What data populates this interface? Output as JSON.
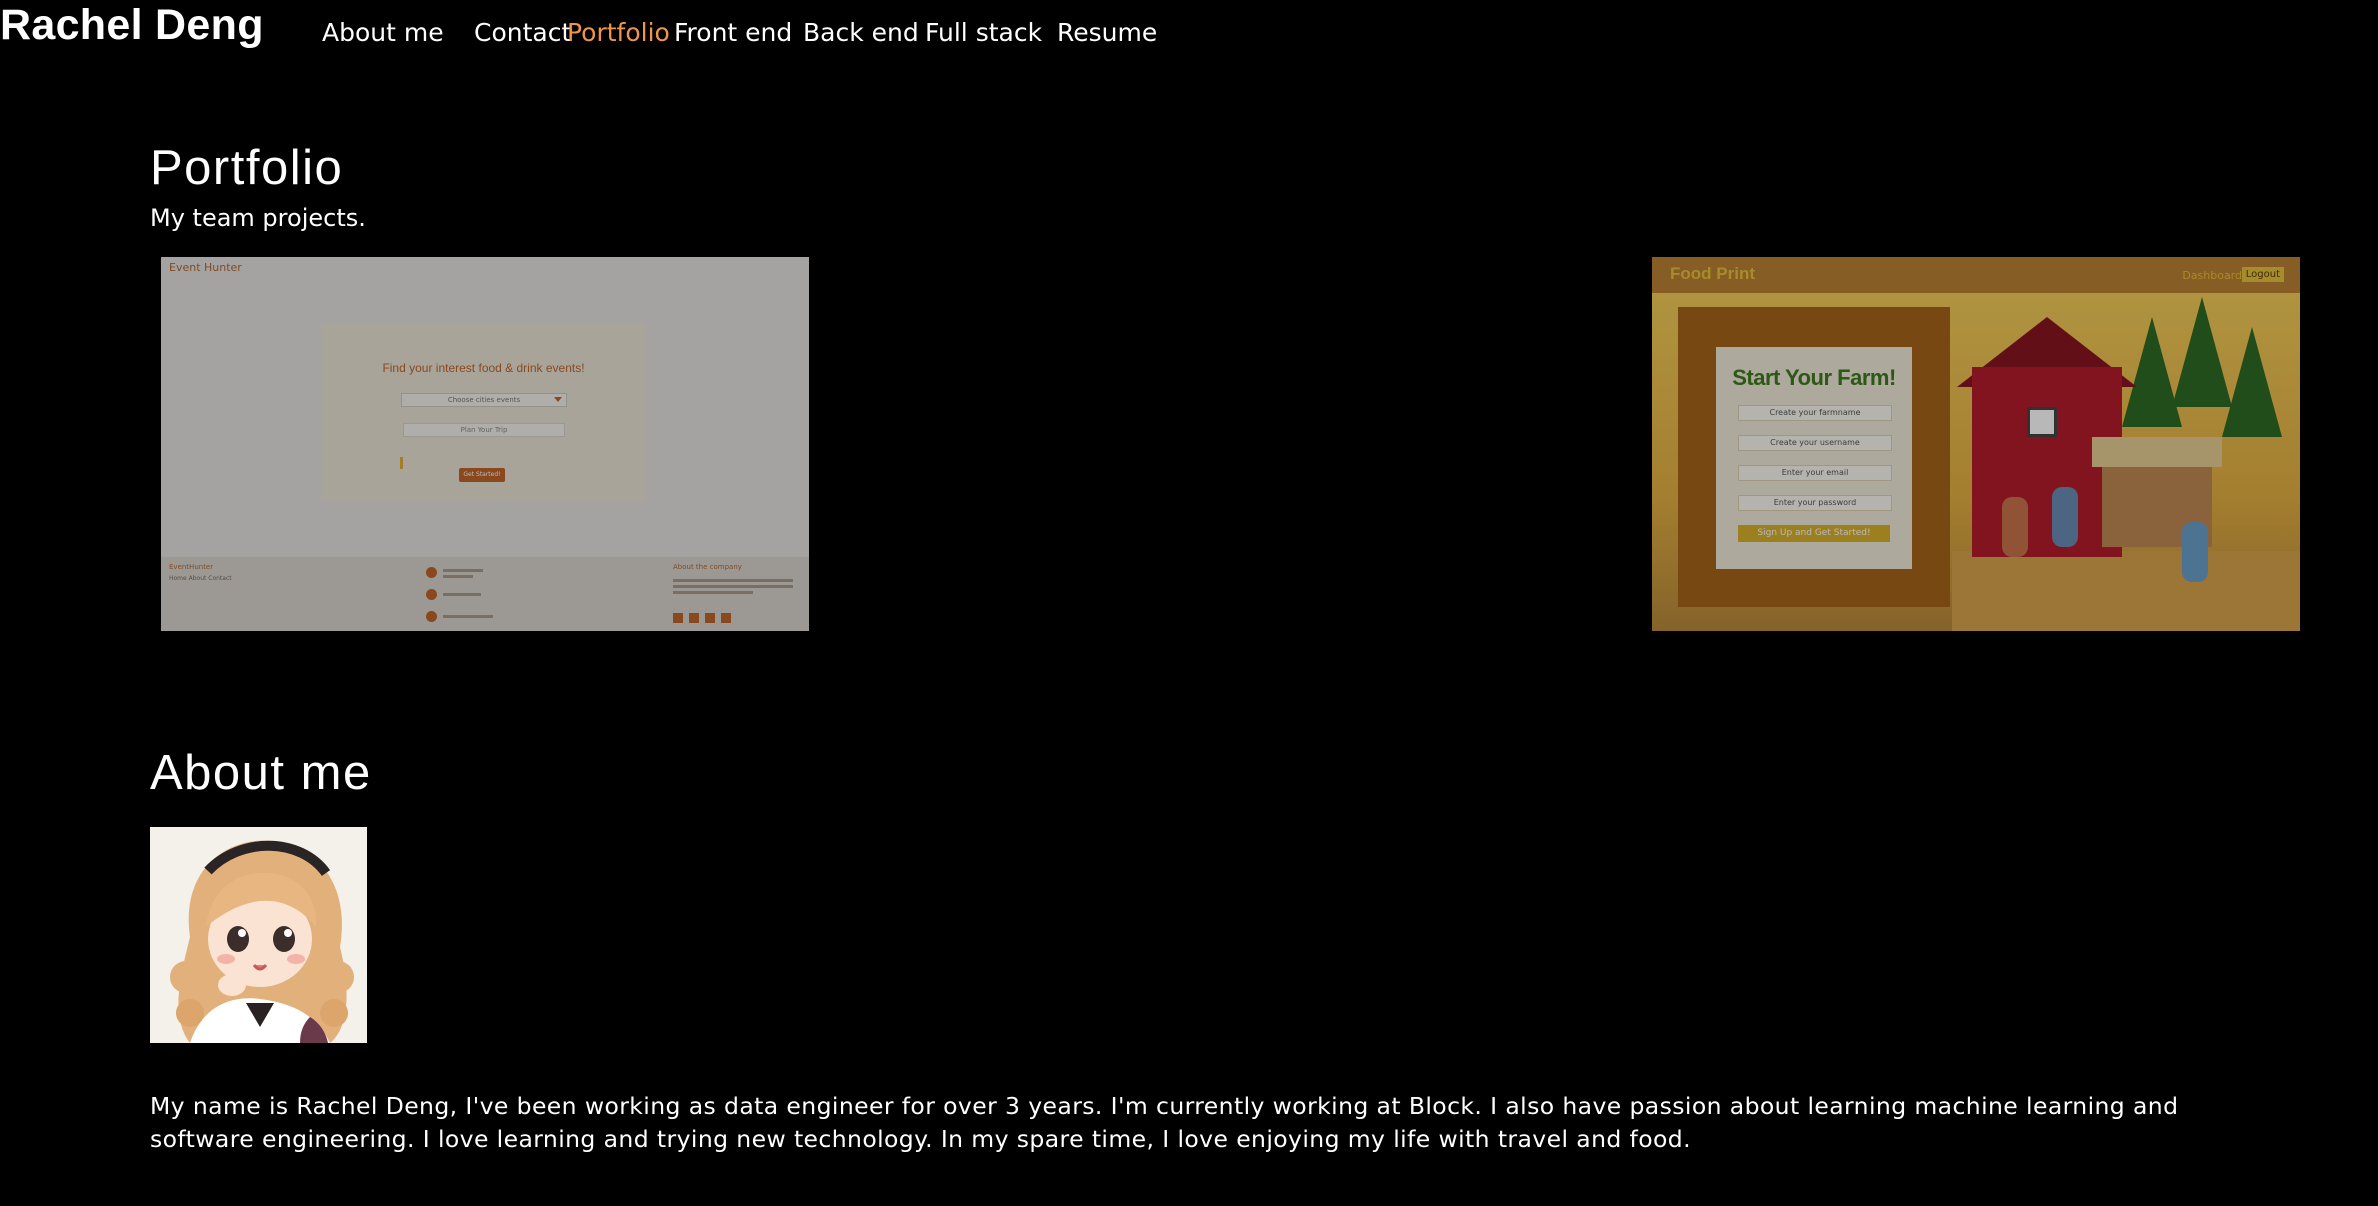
{
  "header": {
    "brand": "Rachel Deng",
    "nav": [
      {
        "label": "About me",
        "active": false
      },
      {
        "label": "Contact",
        "active": false
      },
      {
        "label": "Portfolio",
        "active": true
      },
      {
        "label": "Front end",
        "active": false
      },
      {
        "label": "Back end",
        "active": false
      },
      {
        "label": "Full stack",
        "active": false
      },
      {
        "label": "Resume",
        "active": false
      }
    ],
    "active_color": "#f0944a"
  },
  "portfolio": {
    "title": "Portfolio",
    "subtitle": "My team projects.",
    "projects": [
      {
        "name": "Event Hunter",
        "heading": "Find your interest food & drink events!",
        "select_placeholder": "Choose cities events",
        "input_placeholder": "Plan Your Trip",
        "button": "Get Started!",
        "footer_brand": "EventHunter",
        "footer_links": "Home  About  Contact",
        "footer_about": "About the company"
      },
      {
        "name": "Food Print",
        "nav_dashboard": "Dashboard",
        "nav_logout": "Logout",
        "form_title": "Start Your Farm!",
        "fields": [
          "Create your farmname",
          "Create your username",
          "Enter your email",
          "Enter your password"
        ],
        "button": "Sign Up and Get Started!"
      }
    ]
  },
  "about": {
    "title": "About me",
    "avatar_alt": "cartoon avatar",
    "text": "My name is Rachel Deng, I've been working as data engineer for over 3 years. I'm currently working at Block. I also have passion about learning machine learning and software engineering. I love learning and trying new technology. In my spare time, I love enjoying my life with travel and food."
  }
}
